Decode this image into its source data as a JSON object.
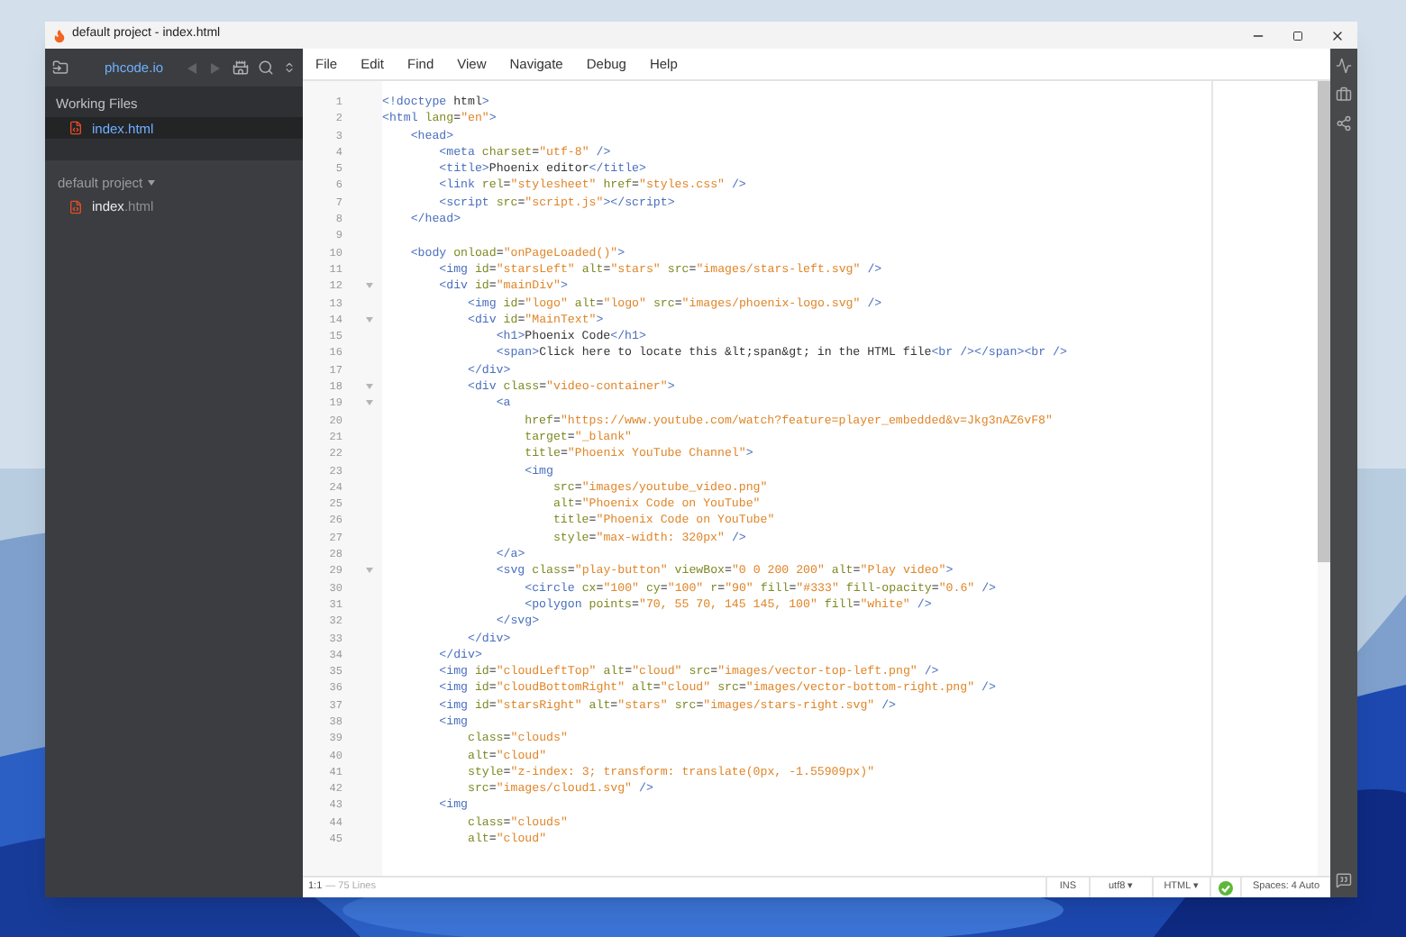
{
  "window": {
    "title": "default project - index.html"
  },
  "sidebar": {
    "brand": "phcode.io",
    "working_files": {
      "title": "Working Files",
      "files": [
        {
          "name": "index",
          "ext": ".html",
          "selected": true
        }
      ]
    },
    "project": {
      "title": "default project",
      "files": [
        {
          "name": "index",
          "ext": ".html",
          "selected": false
        }
      ]
    }
  },
  "menu": [
    "File",
    "Edit",
    "Find",
    "View",
    "Navigate",
    "Debug",
    "Help"
  ],
  "editor": {
    "lines": [
      {
        "number": "1",
        "text": "<!doctype html>",
        "foldable": false
      },
      {
        "number": "2",
        "text": "<html lang=\"en\">",
        "foldable": false
      },
      {
        "number": "3",
        "text": "    <head>",
        "foldable": false
      },
      {
        "number": "4",
        "text": "        <meta charset=\"utf-8\" />",
        "foldable": false
      },
      {
        "number": "5",
        "text": "        <title>Phoenix editor</title>",
        "foldable": false
      },
      {
        "number": "6",
        "text": "        <link rel=\"stylesheet\" href=\"styles.css\" />",
        "foldable": false
      },
      {
        "number": "7",
        "text": "        <script src=\"script.js\"></script>",
        "foldable": false
      },
      {
        "number": "8",
        "text": "    </head>",
        "foldable": false
      },
      {
        "number": "9",
        "foldable": false
      },
      {
        "number": "10",
        "text": "    <body onload=\"onPageLoaded()\">",
        "foldable": false
      },
      {
        "number": "11",
        "text": "        <img id=\"starsLeft\" alt=\"stars\" src=\"images/stars-left.svg\" />",
        "foldable": false
      },
      {
        "number": "12",
        "text": "        <div id=\"mainDiv\">",
        "foldable": true
      },
      {
        "number": "13",
        "text": "            <img id=\"logo\" alt=\"logo\" src=\"images/phoenix-logo.svg\" />",
        "foldable": false
      },
      {
        "number": "14",
        "text": "            <div id=\"MainText\">",
        "foldable": true
      },
      {
        "number": "15",
        "text": "                <h1>Phoenix Code</h1>",
        "foldable": false
      },
      {
        "number": "16",
        "text": "                <span>Click here to locate this &lt;span&gt; in the HTML file<br /></span><br />",
        "foldable": false
      },
      {
        "number": "17",
        "text": "            </div>",
        "foldable": false
      },
      {
        "number": "18",
        "text": "            <div class=\"video-container\">",
        "foldable": true
      },
      {
        "number": "19",
        "text": "                <a",
        "foldable": true
      },
      {
        "number": "20",
        "text": "                    href=\"https://www.youtube.com/watch?feature=player_embedded&v=Jkg3nAZ6vF8\"",
        "foldable": false
      },
      {
        "number": "21",
        "text": "                    target=\"_blank\"",
        "foldable": false
      },
      {
        "number": "22",
        "text": "                    title=\"Phoenix YouTube Channel\">",
        "foldable": false
      },
      {
        "number": "23",
        "text": "                    <img",
        "foldable": false
      },
      {
        "number": "24",
        "text": "                        src=\"images/youtube_video.png\"",
        "foldable": false
      },
      {
        "number": "25",
        "text": "                        alt=\"Phoenix Code on YouTube\"",
        "foldable": false
      },
      {
        "number": "26",
        "text": "                        title=\"Phoenix Code on YouTube\"",
        "foldable": false
      },
      {
        "number": "27",
        "text": "                        style=\"max-width: 320px\" />",
        "foldable": false
      },
      {
        "number": "28",
        "text": "                </a>",
        "foldable": false
      },
      {
        "number": "29",
        "text": "                <svg class=\"play-button\" viewBox=\"0 0 200 200\" alt=\"Play video\">",
        "foldable": true
      },
      {
        "number": "30",
        "text": "                    <circle cx=\"100\" cy=\"100\" r=\"90\" fill=\"#333\" fill-opacity=\"0.6\" />",
        "foldable": false
      },
      {
        "number": "31",
        "text": "                    <polygon points=\"70, 55 70, 145 145, 100\" fill=\"white\" />",
        "foldable": false
      },
      {
        "number": "32",
        "text": "                </svg>",
        "foldable": false
      },
      {
        "number": "33",
        "text": "            </div>",
        "foldable": false
      },
      {
        "number": "34",
        "text": "        </div>",
        "foldable": false
      },
      {
        "number": "35",
        "text": "        <img id=\"cloudLeftTop\" alt=\"cloud\" src=\"images/vector-top-left.png\" />",
        "foldable": false
      },
      {
        "number": "36",
        "text": "        <img id=\"cloudBottomRight\" alt=\"cloud\" src=\"images/vector-bottom-right.png\" />",
        "foldable": false
      },
      {
        "number": "37",
        "text": "        <img id=\"starsRight\" alt=\"stars\" src=\"images/stars-right.svg\" />",
        "foldable": false
      },
      {
        "number": "38",
        "text": "        <img",
        "foldable": false
      },
      {
        "number": "39",
        "text": "            class=\"clouds\"",
        "foldable": false
      },
      {
        "number": "40",
        "text": "            alt=\"cloud\"",
        "foldable": false
      },
      {
        "number": "41",
        "text": "            style=\"z-index: 3; transform: translate(0px, -1.55909px)\"",
        "foldable": false
      },
      {
        "number": "42",
        "text": "            src=\"images/cloud1.svg\" />",
        "foldable": false
      },
      {
        "number": "43",
        "text": "        <img",
        "foldable": false
      },
      {
        "number": "44",
        "text": "            class=\"clouds\"",
        "foldable": false
      },
      {
        "number": "45",
        "text": "            alt=\"cloud\"",
        "foldable": false
      }
    ]
  },
  "status_bar": {
    "cursor": "1:1",
    "line_count": "— 75 Lines",
    "mode": "INS",
    "encoding": "utf8 ▾",
    "language": "HTML ▾",
    "lint_ok": true,
    "indent": "Spaces: 4 Auto"
  }
}
